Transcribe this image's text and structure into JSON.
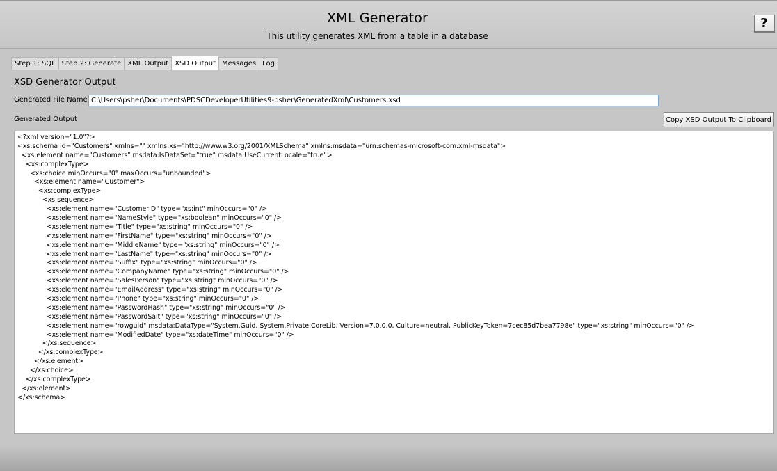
{
  "header": {
    "title": "XML Generator",
    "subtitle": "This utility generates XML from a table in a database",
    "help_label": "?"
  },
  "tabs": [
    {
      "label": "Step 1: SQL",
      "active": false
    },
    {
      "label": "Step 2: Generate",
      "active": false
    },
    {
      "label": "XML Output",
      "active": false
    },
    {
      "label": "XSD Output",
      "active": true
    },
    {
      "label": "Messages",
      "active": false
    },
    {
      "label": "Log",
      "active": false
    }
  ],
  "panel": {
    "title": "XSD Generator Output",
    "file_name_label": "Generated File Name",
    "file_name_value": "C:\\Users\\psher\\Documents\\PDSCDeveloperUtilities9-psher\\GeneratedXml\\Customers.xsd",
    "output_label": "Generated Output",
    "copy_button_label": "Copy XSD Output To Clipboard"
  },
  "output_lines": [
    "<?xml version=\"1.0\"?>",
    "<xs:schema id=\"Customers\" xmlns=\"\" xmlns:xs=\"http://www.w3.org/2001/XMLSchema\" xmlns:msdata=\"urn:schemas-microsoft-com:xml-msdata\">",
    "  <xs:element name=\"Customers\" msdata:IsDataSet=\"true\" msdata:UseCurrentLocale=\"true\">",
    "    <xs:complexType>",
    "      <xs:choice minOccurs=\"0\" maxOccurs=\"unbounded\">",
    "        <xs:element name=\"Customer\">",
    "          <xs:complexType>",
    "            <xs:sequence>",
    "              <xs:element name=\"CustomerID\" type=\"xs:int\" minOccurs=\"0\" />",
    "              <xs:element name=\"NameStyle\" type=\"xs:boolean\" minOccurs=\"0\" />",
    "              <xs:element name=\"Title\" type=\"xs:string\" minOccurs=\"0\" />",
    "              <xs:element name=\"FirstName\" type=\"xs:string\" minOccurs=\"0\" />",
    "              <xs:element name=\"MiddleName\" type=\"xs:string\" minOccurs=\"0\" />",
    "              <xs:element name=\"LastName\" type=\"xs:string\" minOccurs=\"0\" />",
    "              <xs:element name=\"Suffix\" type=\"xs:string\" minOccurs=\"0\" />",
    "              <xs:element name=\"CompanyName\" type=\"xs:string\" minOccurs=\"0\" />",
    "              <xs:element name=\"SalesPerson\" type=\"xs:string\" minOccurs=\"0\" />",
    "              <xs:element name=\"EmailAddress\" type=\"xs:string\" minOccurs=\"0\" />",
    "              <xs:element name=\"Phone\" type=\"xs:string\" minOccurs=\"0\" />",
    "              <xs:element name=\"PasswordHash\" type=\"xs:string\" minOccurs=\"0\" />",
    "              <xs:element name=\"PasswordSalt\" type=\"xs:string\" minOccurs=\"0\" />",
    "              <xs:element name=\"rowguid\" msdata:DataType=\"System.Guid, System.Private.CoreLib, Version=7.0.0.0, Culture=neutral, PublicKeyToken=7cec85d7bea7798e\" type=\"xs:string\" minOccurs=\"0\" />",
    "              <xs:element name=\"ModifiedDate\" type=\"xs:dateTime\" minOccurs=\"0\" />",
    "            </xs:sequence>",
    "          </xs:complexType>",
    "        </xs:element>",
    "      </xs:choice>",
    "    </xs:complexType>",
    "  </xs:element>",
    "</xs:schema>"
  ]
}
